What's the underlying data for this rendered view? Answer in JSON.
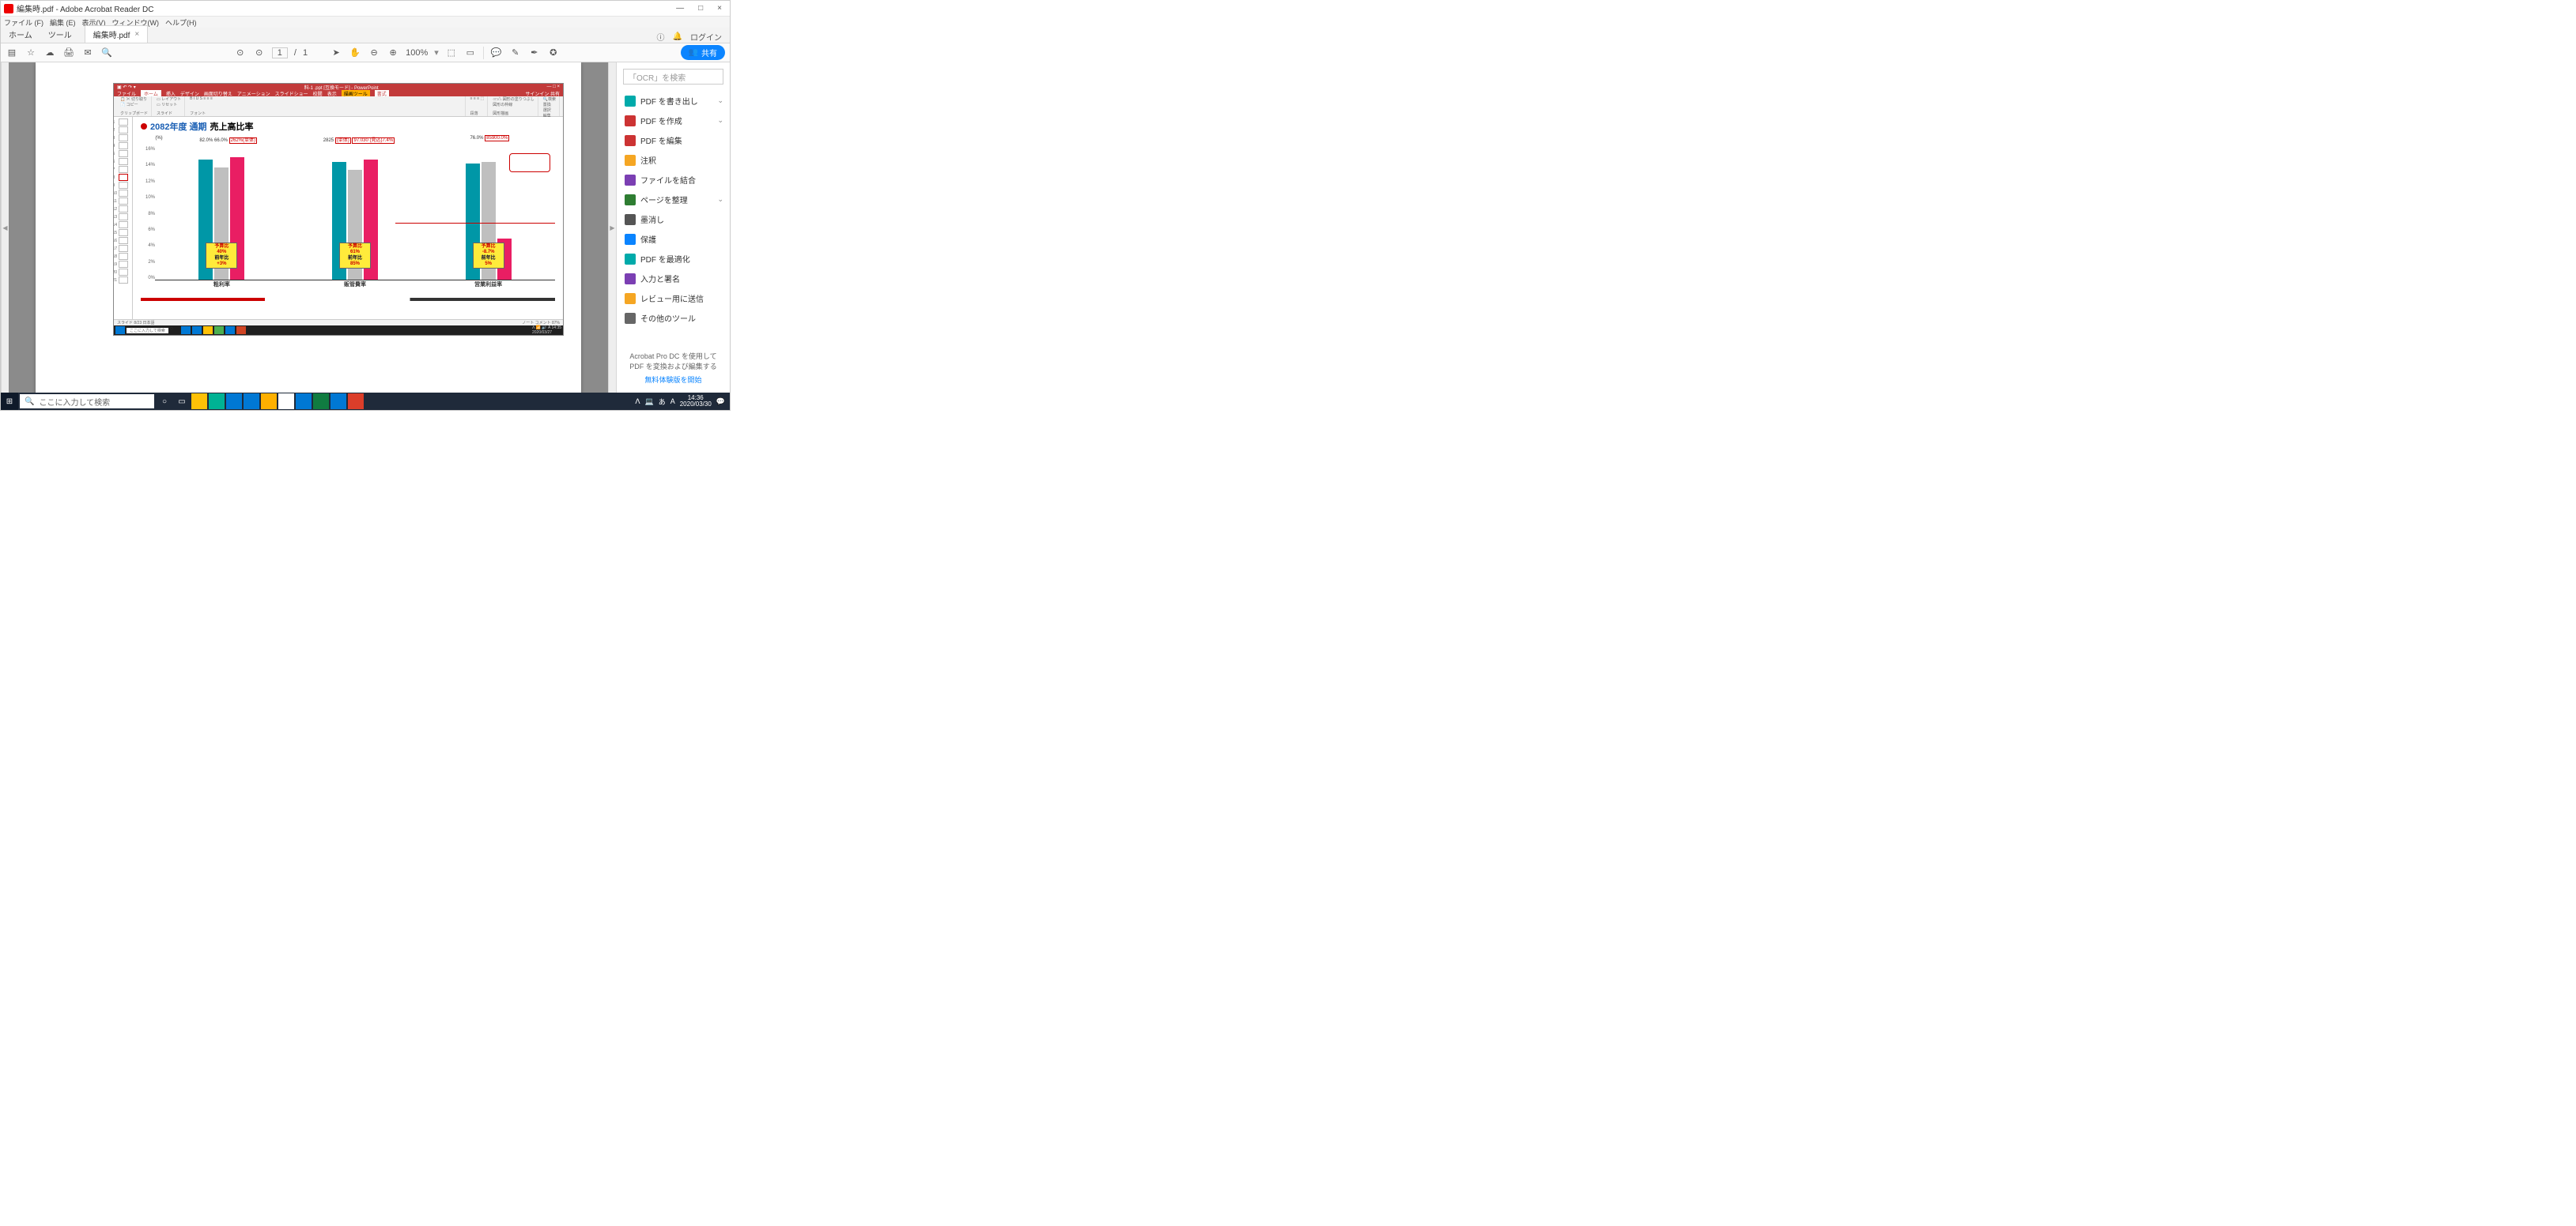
{
  "window": {
    "title": "編集時.pdf - Adobe Acrobat Reader DC",
    "min": "—",
    "max": "□",
    "close": "×"
  },
  "menus": [
    "ファイル (F)",
    "編集 (E)",
    "表示(V)",
    "ウィンドウ(W)",
    "ヘルプ(H)"
  ],
  "tabs": {
    "home": "ホーム",
    "tools": "ツール",
    "doc": "編集時.pdf",
    "login": "ログイン"
  },
  "toolbar": {
    "page_current": "1",
    "page_sep": "/",
    "page_total": "1",
    "zoom": "100%",
    "share": "共有"
  },
  "side": {
    "search_placeholder": "「OCR」を検索",
    "items": [
      {
        "label": "PDF を書き出し",
        "color": "#0aa",
        "chev": true
      },
      {
        "label": "PDF を作成",
        "color": "#c33",
        "chev": true
      },
      {
        "label": "PDF を編集",
        "color": "#c33"
      },
      {
        "label": "注釈",
        "color": "#f5a623"
      },
      {
        "label": "ファイルを結合",
        "color": "#7b3fb3"
      },
      {
        "label": "ページを整理",
        "color": "#2e7d32",
        "chev": true
      },
      {
        "label": "墨消し",
        "color": "#555"
      },
      {
        "label": "保護",
        "color": "#0a84ff"
      },
      {
        "label": "PDF を最適化",
        "color": "#0aa"
      },
      {
        "label": "入力と署名",
        "color": "#7b3fb3"
      },
      {
        "label": "レビュー用に送信",
        "color": "#f5a623"
      },
      {
        "label": "その他のツール",
        "color": "#666"
      }
    ],
    "promo1": "Acrobat Pro DC を使用して",
    "promo2": "PDF を変換および編集する",
    "promo_link": "無料体験版を開始"
  },
  "ppt": {
    "title_left": "",
    "title_right": "料-1 .ppt [互換モード] - PowerPoint",
    "tabs": [
      "ファイル",
      "ホーム",
      "挿入",
      "デザイン",
      "画面切り替え",
      "アニメーション",
      "スライドショー",
      "校閲",
      "表示"
    ],
    "tab_format": "書式",
    "tab_drawing": "描画ツール",
    "signin": "サインイン  共有",
    "ribbon_groups": [
      "クリップボード",
      "スライド",
      "フォント",
      "段落",
      "図形描画",
      "編集"
    ],
    "status_left": "スライド 8/23   日本語",
    "status_right": "ノート   コメント        87%",
    "search_hint": "ここに入力して検索",
    "thumbs": [
      1,
      2,
      3,
      4,
      5,
      6,
      7,
      8,
      9,
      10,
      11,
      12,
      13,
      14,
      15,
      16,
      17,
      18,
      19,
      20,
      21
    ],
    "selected_thumb": 8
  },
  "slide": {
    "title_blue": "2082年度 通期",
    "title_black": "売上高比率",
    "y_unit": "(%)"
  },
  "chart_data": {
    "type": "bar",
    "ylabel": "(%)",
    "ylim": [
      0,
      16
    ],
    "yticks": [
      0,
      2,
      4,
      6,
      8,
      10,
      12,
      14,
      16
    ],
    "categories": [
      "粗利率",
      "販管費率",
      "営業利益率"
    ],
    "series": [
      {
        "name": "teal",
        "values": [
          14.5,
          14.2,
          14.0
        ]
      },
      {
        "name": "grey",
        "values": [
          13.5,
          13.2,
          14.2
        ]
      },
      {
        "name": "pink",
        "values": [
          14.8,
          14.5,
          5.0
        ]
      }
    ],
    "header_cells": [
      [
        "82.0%",
        "66.0%",
        "262%(単体)"
      ],
      [
        "2825",
        "(単体)",
        "97.030 (見込)7.4%"
      ],
      [
        "76.0%",
        "85900.0%",
        ""
      ]
    ],
    "yellow_boxes": [
      {
        "l1": "予算比",
        "l2": "40%",
        "l3": "前年比",
        "l4": "+3%"
      },
      {
        "l1": "予算比",
        "l2": "61%",
        "l3": "前年比",
        "l4": "85%"
      },
      {
        "l1": "予算比",
        "l2": "-8.7%",
        "l3": "前年比",
        "l4": "5%"
      }
    ]
  },
  "wtaskbar": {
    "search_placeholder": "ここに入力して検索",
    "time": "14:36",
    "date": "2020/03/30"
  }
}
